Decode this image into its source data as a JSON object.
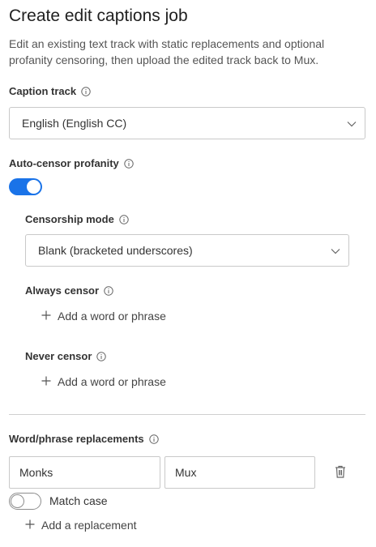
{
  "page": {
    "title": "Create edit captions job",
    "description": "Edit an existing text track with static replacements and optional profanity censoring, then upload the edited track back to Mux."
  },
  "caption_track": {
    "label": "Caption track",
    "selected": "English (English CC)"
  },
  "auto_censor": {
    "label": "Auto-censor profanity",
    "enabled": true
  },
  "censorship_mode": {
    "label": "Censorship mode",
    "selected": "Blank (bracketed underscores)"
  },
  "always_censor": {
    "label": "Always censor",
    "add_label": "Add a word or phrase"
  },
  "never_censor": {
    "label": "Never censor",
    "add_label": "Add a word or phrase"
  },
  "replacements": {
    "label": "Word/phrase replacements",
    "rows": [
      {
        "find": "Monks",
        "replace": "Mux"
      }
    ],
    "match_case_label": "Match case",
    "match_case_enabled": false,
    "add_label": "Add a replacement"
  },
  "colors": {
    "accent": "#1a73e8",
    "border": "#c9c9c9",
    "text": "#333333"
  },
  "icons": [
    "info-icon",
    "chevron-down-icon",
    "plus-icon",
    "trash-icon"
  ]
}
